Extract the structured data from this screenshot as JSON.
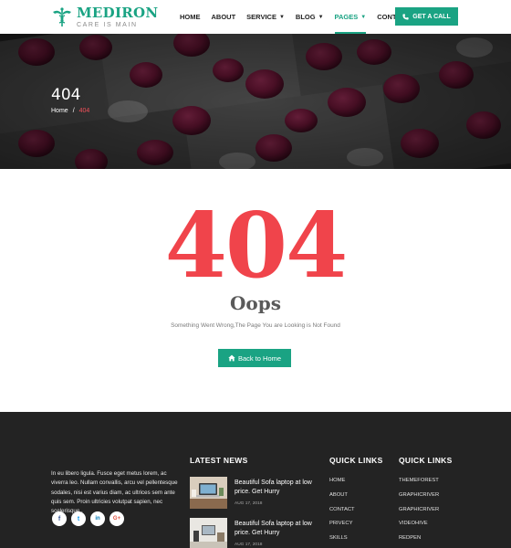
{
  "header": {
    "logo_name": "MEDIRON",
    "logo_tagline": "CARE IS MAIN",
    "nav": [
      {
        "label": "HOME"
      },
      {
        "label": "ABOUT"
      },
      {
        "label": "SERVICE"
      },
      {
        "label": "BLOG"
      },
      {
        "label": "PAGES"
      },
      {
        "label": "CONTACT"
      }
    ],
    "call_button": "GET A CALL"
  },
  "hero": {
    "title": "404",
    "breadcrumb": {
      "home": "Home",
      "separator": "/",
      "current": "404"
    }
  },
  "error": {
    "code": "404",
    "heading": "Oops",
    "message": "Something Went Wrong,The Page You are Looking is Not Found",
    "button": "Back to Home"
  },
  "footer": {
    "about": "In eu libero ligula. Fusce eget metus lorem, ac viverra leo. Nullam convallis, arcu vel pellentesque sodales, nisi est varius diam, ac ultrices sem ante quis sem. Proin ultricies volutpat sapien, nec scelerisque .",
    "socials": [
      "f",
      "t",
      "in",
      "G+"
    ],
    "latest_news": {
      "heading": "LATEST NEWS",
      "items": [
        {
          "title": "Beautiful Sofa laptop at low price. Get Hurry",
          "date": "AUG 17, 2018"
        },
        {
          "title": "Beautiful Sofa laptop at low price. Get Hurry",
          "date": "AUG 17, 2018"
        }
      ]
    },
    "quick_links_1": {
      "heading": "QUICK LINKS",
      "items": [
        "HOME",
        "ABOUT",
        "CONTACT",
        "PRIVECY",
        "SKILLS"
      ]
    },
    "quick_links_2": {
      "heading": "QUICK LINKS",
      "items": [
        "THEMEFOREST",
        "GRAPHICRIVER",
        "GRAPHICRIVER",
        "VIDEOHIVE",
        "REDPEN"
      ]
    }
  },
  "colors": {
    "brand": "#1aa383",
    "error": "#f0444b",
    "footer_bg": "#232323"
  }
}
